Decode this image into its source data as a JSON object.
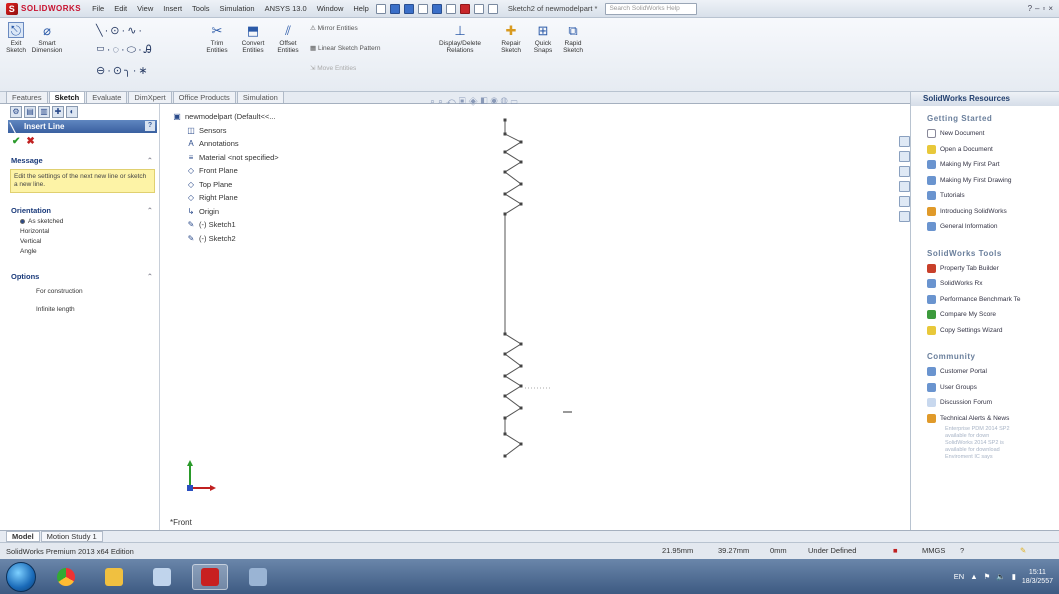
{
  "app": {
    "logo_text": "SOLIDWORKS",
    "document_title": "Sketch2 of newmodelpart *",
    "search_placeholder": "Search SolidWorks Help"
  },
  "menu": [
    "File",
    "Edit",
    "View",
    "Insert",
    "Tools",
    "Simulation",
    "ANSYS 13.0",
    "Window",
    "Help"
  ],
  "commands": {
    "exit_sketch": "Exit Sketch",
    "smart_dimension": "Smart Dimension",
    "trim_entities": "Trim Entities",
    "convert_entities": "Convert Entities",
    "offset_entities": "Offset Entities",
    "mirror_entities": "Mirror Entities",
    "linear_sketch_pattern": "Linear Sketch Pattern",
    "move_entities": "Move Entities",
    "display_delete_relations": "Display/Delete Relations",
    "repair_sketch": "Repair Sketch",
    "quick_snaps": "Quick Snaps",
    "rapid_sketch": "Rapid Sketch"
  },
  "tabs": [
    "Features",
    "Sketch",
    "Evaluate",
    "DimXpert",
    "Office Products",
    "Simulation"
  ],
  "active_tab": "Sketch",
  "property_manager": {
    "title": "Insert Line",
    "help": "?",
    "ok_symbol": "✔",
    "cancel_symbol": "✖",
    "message_title": "Message",
    "message_text": "Edit the settings of the next new line or sketch a new line.",
    "orientation_title": "Orientation",
    "orientation_options": [
      "As sketched",
      "Horizontal",
      "Vertical",
      "Angle"
    ],
    "options_title": "Options",
    "options": [
      "For construction",
      "Infinite length"
    ],
    "collapse_symbol": "⌃"
  },
  "tree": {
    "root": "newmodelpart (Default<<...",
    "items": [
      "Sensors",
      "Annotations",
      "Material <not specified>",
      "Front Plane",
      "Top Plane",
      "Right Plane",
      "Origin",
      "(-) Sketch1",
      "(-) Sketch2"
    ]
  },
  "graphics": {
    "view_label": "*Front"
  },
  "task_pane": {
    "title": "SolidWorks Resources",
    "sections": [
      {
        "title": "Getting Started",
        "items": [
          "New Document",
          "Open a Document",
          "Making My First Part",
          "Making My First Drawing",
          "Tutorials",
          "Introducing SolidWorks",
          "General Information"
        ]
      },
      {
        "title": "SolidWorks Tools",
        "items": [
          "Property Tab Builder",
          "SolidWorks Rx",
          "Performance Benchmark Te",
          "Compare My Score",
          "Copy Settings Wizard"
        ]
      },
      {
        "title": "Community",
        "items": [
          "Customer Portal",
          "User Groups",
          "Discussion Forum",
          "Technical Alerts & News"
        ]
      }
    ],
    "faded_news": [
      "Enterprise PDM 2014 SP2",
      "available for down",
      "SolidWorks 2014 SP2 is",
      "available for download",
      "Enviroment IC says"
    ]
  },
  "bottom_tabs": [
    "Model",
    "Motion Study 1"
  ],
  "status": {
    "edition": "SolidWorks Premium 2013 x64 Edition",
    "x": "21.95mm",
    "y": "39.27mm",
    "z": "0mm",
    "state": "Under Defined",
    "units": "MMGS"
  },
  "taskbar": {
    "lang": "EN",
    "time": "15:11",
    "date": "18/3/2557"
  }
}
